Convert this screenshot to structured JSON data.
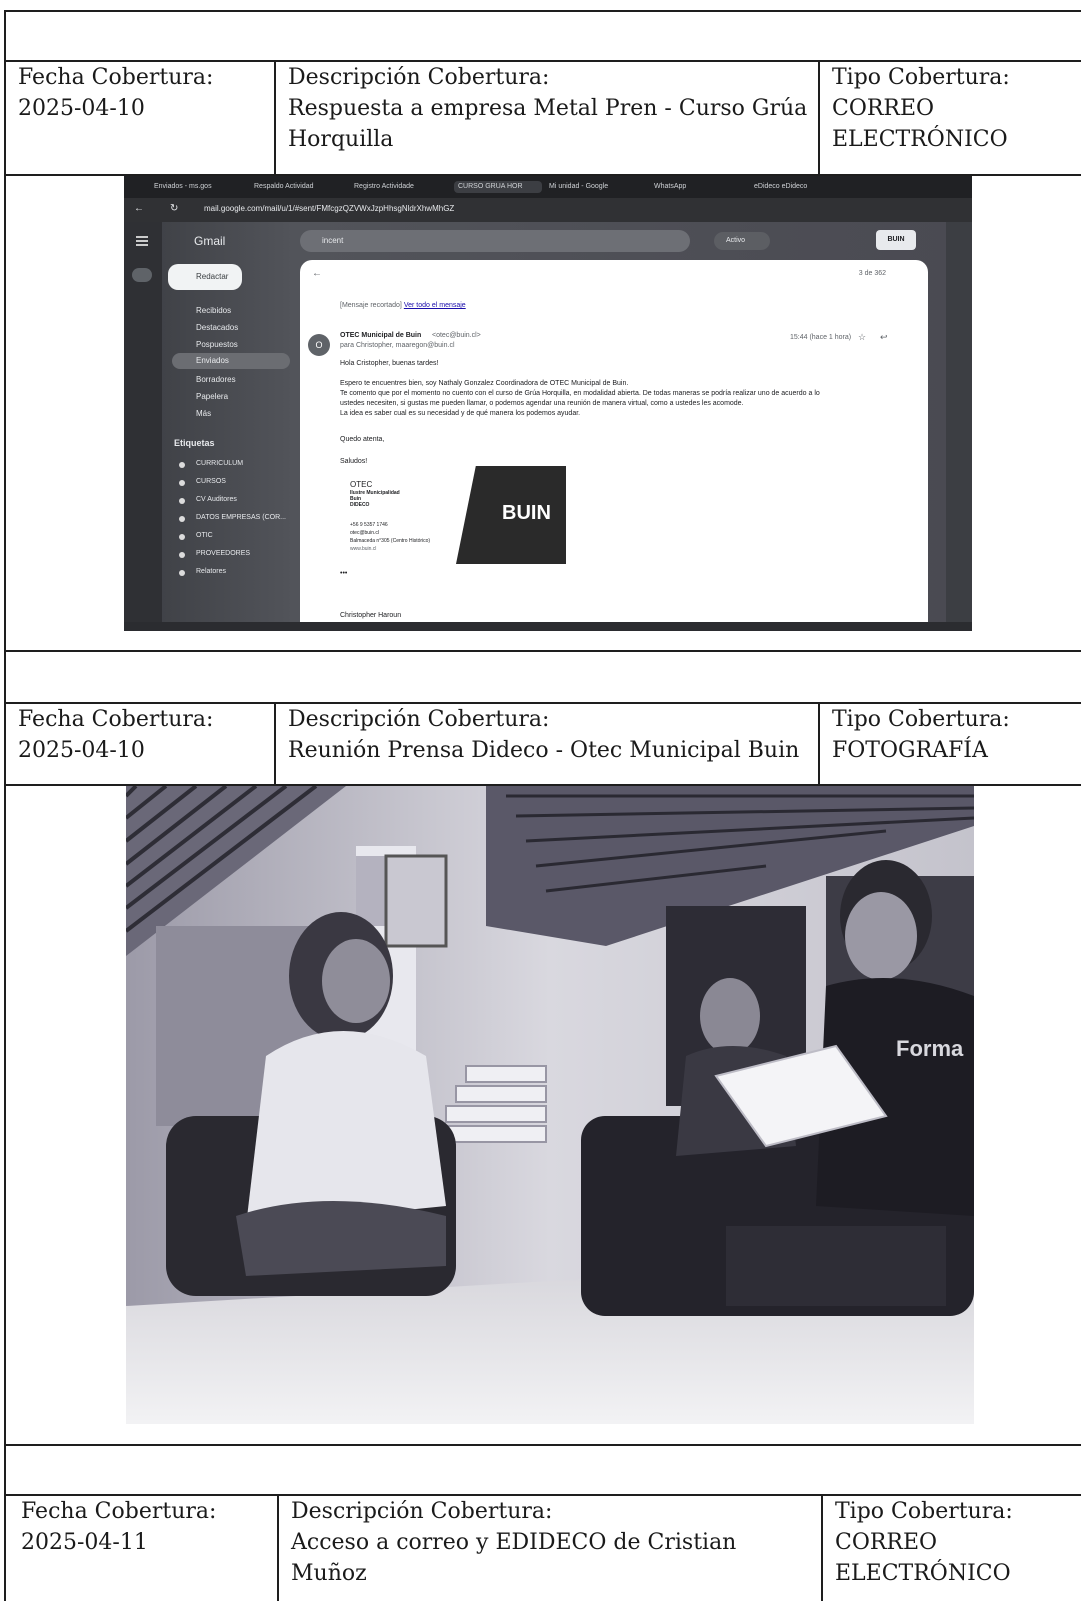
{
  "entries": [
    {
      "fecha_label": "Fecha Cobertura:",
      "fecha": "2025-04-10",
      "desc_label": "Descripción Cobertura:",
      "desc_line1": "Respuesta a empresa Metal Pren - Curso Grúa",
      "desc_line2": "Horquilla",
      "tipo_label": "Tipo Cobertura:",
      "tipo_line1": "CORREO",
      "tipo_line2": "ELECTRÓNICO"
    },
    {
      "fecha_label": "Fecha Cobertura:",
      "fecha": "2025-04-10",
      "desc_label": "Descripción Cobertura:",
      "desc_line1": "Reunión Prensa Dideco - Otec Municipal Buin",
      "tipo_label": "Tipo Cobertura:",
      "tipo_line1": "FOTOGRAFÍA"
    },
    {
      "fecha_label": "Fecha Cobertura:",
      "fecha": "2025-04-11",
      "desc_label": "Descripción Cobertura:",
      "desc_line1": "Acceso a correo y EDIDECO de Cristian Muñoz",
      "tipo_label": "Tipo Cobertura:",
      "tipo_line1": "CORREO",
      "tipo_line2": "ELECTRÓNICO"
    }
  ],
  "gmail": {
    "tabs": [
      "Enviados - ms.gos",
      "Respaldo Actividad",
      "Registro Actividade",
      "CURSO GRUA HOR",
      "Mi unidad - Google",
      "WhatsApp",
      "eDideco eDideco"
    ],
    "url": "mail.google.com/mail/u/1/#sent/FMfcgzQZVWxJzpHhsgNldrXhwMhGZ",
    "app_name": "Gmail",
    "compose": "Redactar",
    "nav": [
      "Recibidos",
      "Destacados",
      "Pospuestos",
      "Enviados",
      "Borradores",
      "Papelera",
      "Más"
    ],
    "labels_title": "Etiquetas",
    "labels": [
      "CURRICULUM",
      "CURSOS",
      "CV Auditores",
      "DATOS EMPRESAS (COR...",
      "OTIC",
      "PROVEEDORES",
      "Relatores"
    ],
    "search": "incent",
    "status": "Activo",
    "brand": "BUIN",
    "pager": "3 de 362",
    "trimmed": "[Mensaje recortado]",
    "view_all": "Ver todo el mensaje",
    "sender": "OTEC Municipal de Buin",
    "sender_email": "<otec@buin.cl>",
    "to_line": "para Christopher, maaregon@buin.cl",
    "time": "15:44 (hace 1 hora)",
    "greeting": "Hola Cristopher, buenas tardes!",
    "body": [
      "Espero te encuentres bien, soy Nathaly Gonzalez Coordinadora de OTEC Municipal de Buin.",
      "Te comento que por el momento no cuento con el curso de Grúa Horquilla, en modalidad abierta. De todas maneras se podría realizar uno de acuerdo a lo",
      "ustedes necesiten, si gustas me pueden llamar, o podemos agendar una reunión de manera virtual, como a ustedes les acomode.",
      "La idea es saber cual es su necesidad y de qué manera los podemos ayudar."
    ],
    "closing": "Quedo atenta,",
    "saludos": "Saludos!",
    "sig": [
      "OTEC",
      "Ilustre Municipalidad",
      "Buin",
      "DIDECO",
      "+56 9 5357 1746",
      "otec@buin.cl",
      "Balmaceda n°305 (Centro Histórico)",
      "www.buin.cl"
    ],
    "avatar_letter": "O",
    "next_sender": "Christopher Haroun"
  }
}
